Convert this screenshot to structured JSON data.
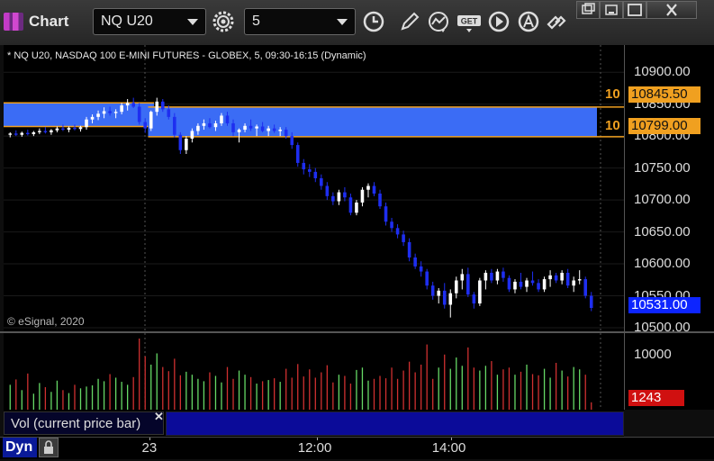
{
  "window": {
    "title": "Chart"
  },
  "toolbar": {
    "symbol": "NQ U20",
    "interval": "5",
    "icons": [
      "settings-icon",
      "clock-icon",
      "pencil-icon",
      "indicator-icon",
      "get-icon",
      "play-icon",
      "annotation-icon",
      "link-icon"
    ],
    "window_buttons": [
      "restore-icon",
      "minimize-icon",
      "maximize-icon",
      "close-icon"
    ]
  },
  "chart": {
    "header": "* NQ U20, NASDAQ 100 E-MINI FUTURES - GLOBEX, 5, 09:30-16:15 (Dynamic)",
    "copyright": "© eSignal, 2020",
    "price_labels": [
      "10900.00",
      "10850.00",
      "10800.00",
      "10750.00",
      "10700.00",
      "10650.00",
      "10600.00",
      "10550.00",
      "10500.00"
    ],
    "zone_upper_tag": "10845.50",
    "zone_lower_tag": "10799.00",
    "zone_prefix": "10",
    "last_price_tag": "10531.00",
    "colors": {
      "up": "#ffffff",
      "down": "#1e2ef0",
      "zone": "#3b6cf5",
      "zone_line": "#f0a020",
      "last_tag": "#0d25ff",
      "vol_tag": "#d01010"
    }
  },
  "chart_data": {
    "type": "candlestick",
    "title": "* NQ U20, NASDAQ 100 E-MINI FUTURES - GLOBEX, 5, 09:30-16:15 (Dynamic)",
    "ylim": [
      10500,
      10920
    ],
    "x_tick_labels": [
      "23",
      "12:00",
      "14:00"
    ],
    "candles": [
      [
        10802,
        10806,
        10798,
        10804
      ],
      [
        10804,
        10809,
        10800,
        10802
      ],
      [
        10802,
        10807,
        10799,
        10805
      ],
      [
        10805,
        10810,
        10801,
        10803
      ],
      [
        10803,
        10808,
        10800,
        10806
      ],
      [
        10806,
        10812,
        10803,
        10808
      ],
      [
        10808,
        10814,
        10804,
        10806
      ],
      [
        10806,
        10811,
        10802,
        10809
      ],
      [
        10809,
        10815,
        10806,
        10812
      ],
      [
        10812,
        10818,
        10808,
        10810
      ],
      [
        10810,
        10815,
        10806,
        10813
      ],
      [
        10813,
        10818,
        10809,
        10811
      ],
      [
        10811,
        10816,
        10807,
        10814
      ],
      [
        10814,
        10830,
        10810,
        10826
      ],
      [
        10826,
        10834,
        10820,
        10830
      ],
      [
        10830,
        10840,
        10825,
        10835
      ],
      [
        10835,
        10845,
        10828,
        10839
      ],
      [
        10839,
        10846,
        10832,
        10836
      ],
      [
        10836,
        10842,
        10828,
        10838
      ],
      [
        10838,
        10852,
        10834,
        10848
      ],
      [
        10848,
        10858,
        10840,
        10852
      ],
      [
        10852,
        10860,
        10844,
        10846
      ],
      [
        10846,
        10852,
        10818,
        10822
      ],
      [
        10822,
        10828,
        10805,
        10812
      ],
      [
        10812,
        10840,
        10808,
        10838
      ],
      [
        10838,
        10860,
        10832,
        10854
      ],
      [
        10854,
        10858,
        10838,
        10842
      ],
      [
        10842,
        10848,
        10826,
        10830
      ],
      [
        10830,
        10836,
        10798,
        10802
      ],
      [
        10802,
        10806,
        10772,
        10778
      ],
      [
        10778,
        10800,
        10772,
        10796
      ],
      [
        10796,
        10812,
        10790,
        10808
      ],
      [
        10808,
        10820,
        10802,
        10816
      ],
      [
        10816,
        10826,
        10810,
        10820
      ],
      [
        10820,
        10828,
        10812,
        10814
      ],
      [
        10814,
        10824,
        10808,
        10820
      ],
      [
        10820,
        10836,
        10816,
        10832
      ],
      [
        10832,
        10838,
        10816,
        10820
      ],
      [
        10820,
        10826,
        10800,
        10806
      ],
      [
        10806,
        10812,
        10790,
        10810
      ],
      [
        10810,
        10820,
        10806,
        10816
      ],
      [
        10816,
        10826,
        10808,
        10812
      ],
      [
        10812,
        10818,
        10800,
        10815
      ],
      [
        10815,
        10822,
        10806,
        10808
      ],
      [
        10808,
        10816,
        10800,
        10812
      ],
      [
        10812,
        10818,
        10805,
        10808
      ],
      [
        10808,
        10814,
        10800,
        10810
      ],
      [
        10810,
        10814,
        10796,
        10800
      ],
      [
        10800,
        10806,
        10780,
        10786
      ],
      [
        10786,
        10790,
        10752,
        10758
      ],
      [
        10758,
        10764,
        10740,
        10748
      ],
      [
        10748,
        10756,
        10736,
        10744
      ],
      [
        10744,
        10750,
        10728,
        10734
      ],
      [
        10734,
        10740,
        10716,
        10722
      ],
      [
        10722,
        10728,
        10700,
        10706
      ],
      [
        10706,
        10712,
        10692,
        10698
      ],
      [
        10698,
        10716,
        10692,
        10712
      ],
      [
        10712,
        10720,
        10698,
        10704
      ],
      [
        10704,
        10710,
        10676,
        10680
      ],
      [
        10680,
        10700,
        10676,
        10696
      ],
      [
        10696,
        10720,
        10690,
        10716
      ],
      [
        10716,
        10726,
        10704,
        10722
      ],
      [
        10722,
        10728,
        10706,
        10710
      ],
      [
        10710,
        10716,
        10686,
        10690
      ],
      [
        10690,
        10696,
        10660,
        10666
      ],
      [
        10666,
        10672,
        10650,
        10656
      ],
      [
        10656,
        10662,
        10640,
        10646
      ],
      [
        10646,
        10652,
        10628,
        10634
      ],
      [
        10634,
        10640,
        10604,
        10610
      ],
      [
        10610,
        10616,
        10592,
        10596
      ],
      [
        10596,
        10604,
        10580,
        10588
      ],
      [
        10588,
        10592,
        10560,
        10566
      ],
      [
        10566,
        10572,
        10544,
        10550
      ],
      [
        10550,
        10562,
        10538,
        10558
      ],
      [
        10558,
        10570,
        10530,
        10536
      ],
      [
        10536,
        10560,
        10516,
        10554
      ],
      [
        10554,
        10580,
        10546,
        10574
      ],
      [
        10574,
        10592,
        10560,
        10584
      ],
      [
        10584,
        10594,
        10548,
        10552
      ],
      [
        10552,
        10556,
        10530,
        10538
      ],
      [
        10538,
        10578,
        10534,
        10574
      ],
      [
        10574,
        10590,
        10560,
        10586
      ],
      [
        10586,
        10592,
        10570,
        10574
      ],
      [
        10574,
        10592,
        10568,
        10588
      ],
      [
        10588,
        10594,
        10572,
        10578
      ],
      [
        10578,
        10582,
        10556,
        10560
      ],
      [
        10560,
        10576,
        10554,
        10572
      ],
      [
        10572,
        10586,
        10560,
        10564
      ],
      [
        10564,
        10578,
        10556,
        10574
      ],
      [
        10574,
        10588,
        10566,
        10570
      ],
      [
        10570,
        10576,
        10556,
        10560
      ],
      [
        10560,
        10580,
        10556,
        10576
      ],
      [
        10576,
        10590,
        10564,
        10582
      ],
      [
        10582,
        10586,
        10570,
        10574
      ],
      [
        10574,
        10590,
        10568,
        10586
      ],
      [
        10586,
        10592,
        10562,
        10566
      ],
      [
        10566,
        10580,
        10556,
        10574
      ],
      [
        10574,
        10590,
        10568,
        10576
      ],
      [
        10576,
        10580,
        10546,
        10550
      ],
      [
        10550,
        10556,
        10526,
        10531
      ]
    ],
    "zones": [
      {
        "low": 10815,
        "high": 10852,
        "start_bar": 0,
        "end_bar": 25
      },
      {
        "low": 10799,
        "high": 10845.5,
        "start_bar": 24,
        "end_bar": 100
      }
    ],
    "volume": {
      "label": "Vol (current price bar)",
      "ylabel_tick": "10000",
      "ylim": [
        0,
        12000
      ],
      "last_value": "1243",
      "values": [
        4200,
        5100,
        3300,
        6100,
        2700,
        4500,
        3800,
        3000,
        4900,
        3300,
        2800,
        4200,
        3600,
        3900,
        4100,
        5200,
        4800,
        6000,
        5400,
        4700,
        4200,
        5500,
        12000,
        9000,
        7600,
        9500,
        7200,
        6500,
        8600,
        5800,
        6400,
        5900,
        5200,
        4800,
        6300,
        5700,
        4600,
        7200,
        5200,
        6600,
        5900,
        5500,
        4400,
        4800,
        5000,
        5300,
        4700,
        6900,
        5400,
        7700,
        5600,
        6800,
        5400,
        6300,
        7500,
        4600,
        5900,
        5700,
        4400,
        6700,
        7100,
        4900,
        5200,
        5700,
        5300,
        7100,
        5200,
        6600,
        8100,
        6300,
        7600,
        11000,
        5200,
        7100,
        9300,
        6900,
        8800,
        7400,
        10500,
        7100,
        6600,
        7400,
        8200,
        5900,
        6800,
        7100,
        5900,
        6400,
        7600,
        6000,
        5800,
        6900,
        5400,
        7900,
        6600,
        5600,
        7200,
        6800,
        5900,
        1243
      ],
      "colors": {
        "up": "#66d966",
        "down": "#d03030"
      }
    }
  },
  "x_axis": {
    "labels": [
      "23",
      "12:00",
      "14:00"
    ]
  },
  "footer": {
    "mode": "Dyn"
  }
}
